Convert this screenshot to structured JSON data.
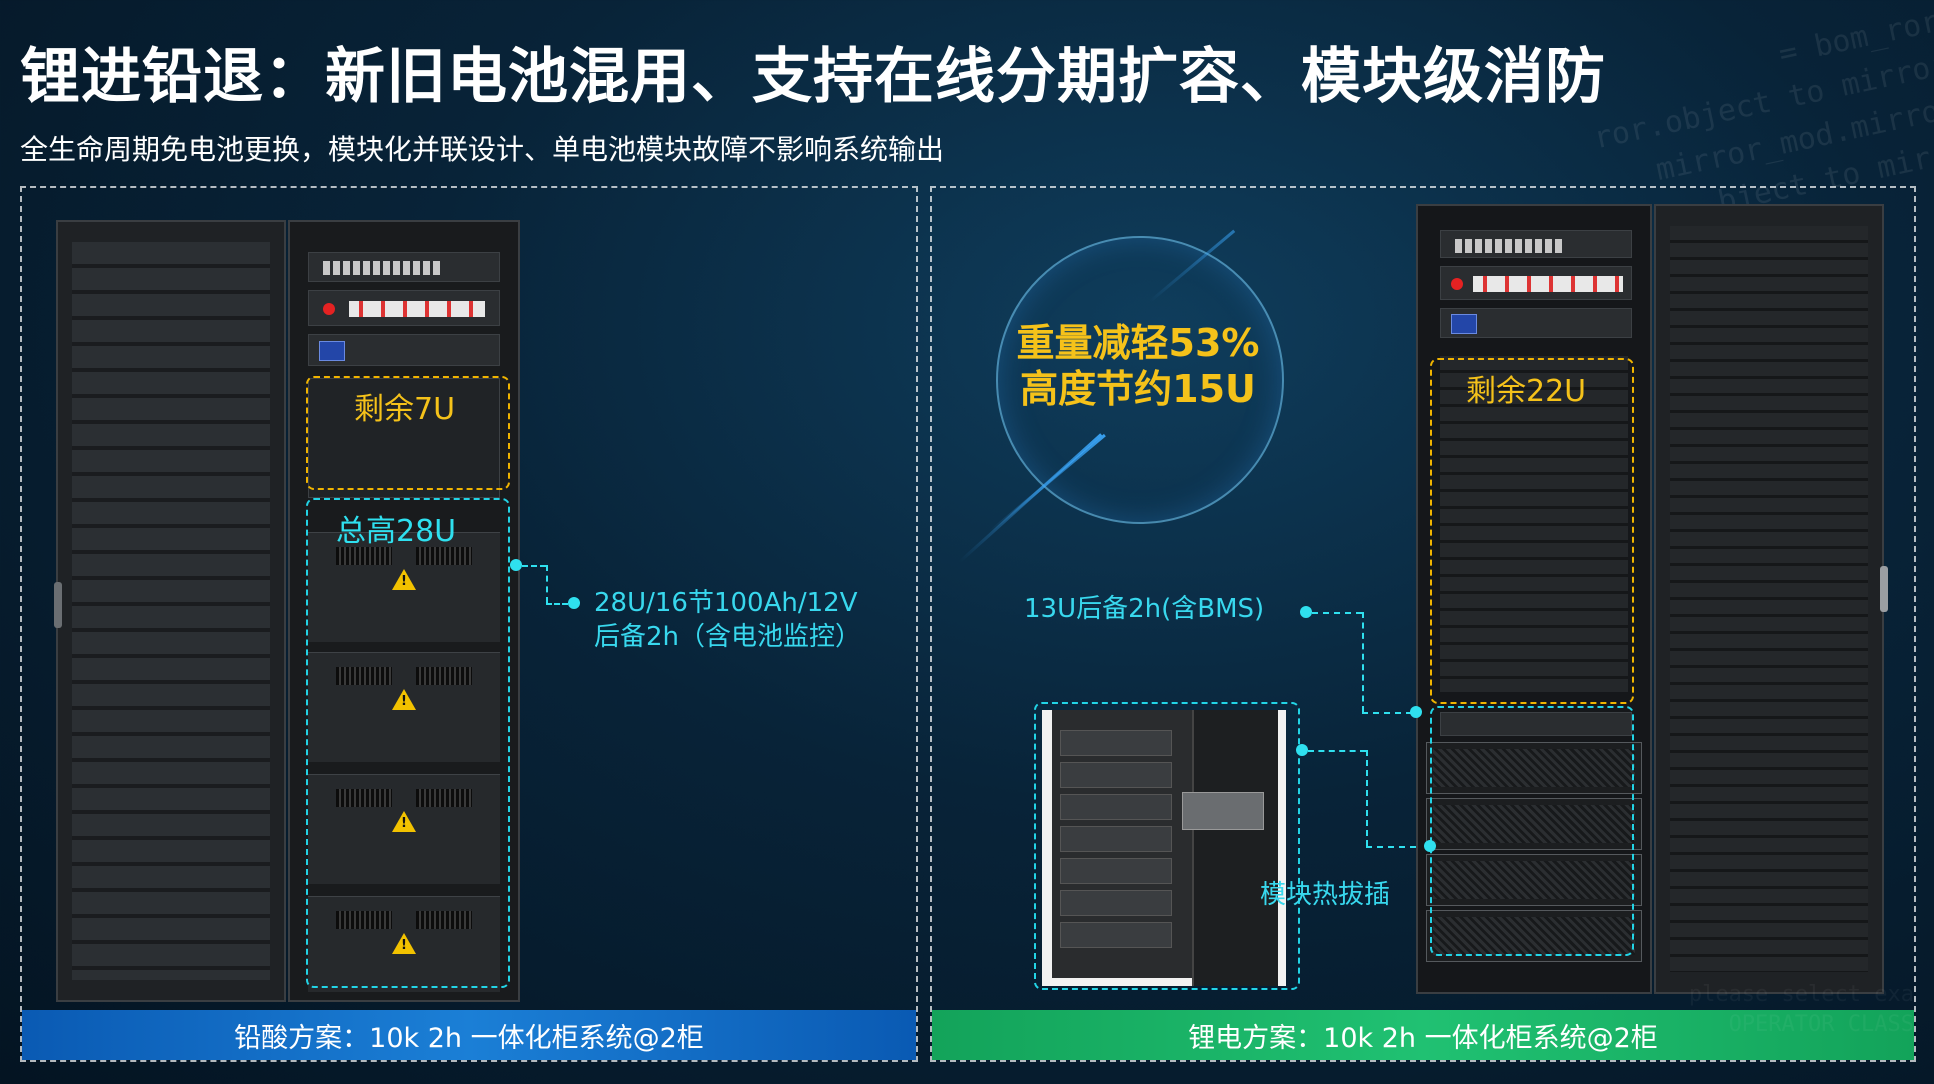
{
  "header": {
    "title": "锂进铅退：新旧电池混用、支持在线分期扩容、模块级消防",
    "subtitle": "全生命周期免电池更换，模块化并联设计、单电池模块故障不影响系统输出"
  },
  "background_code": {
    "lines": [
      "= bom_ror",
      "ror.object to mirror",
      "mirror_mod.mirror",
      "bject to mirro"
    ]
  },
  "left_panel": {
    "remaining_label": "剩余7U",
    "total_height_label": "总高28U",
    "spec_line1": "28U/16节100Ah/12V",
    "spec_line2": "后备2h（含电池监控）",
    "footer": "铅酸方案：10k 2h  一体化柜系统@2柜"
  },
  "right_panel": {
    "circle_line1": "重量减轻53%",
    "circle_line2": "高度节约15U",
    "remaining_label": "剩余22U",
    "backup_label": "13U后备2h(含BMS)",
    "hotswap_label": "模块热拔插",
    "footer": "锂电方案：10k 2h  一体化柜系统@2柜",
    "bottom_code": [
      "please select exa",
      "OPERATOR CLASS"
    ]
  },
  "colors": {
    "accent_yellow": "#f5c21a",
    "accent_cyan": "#2fe0ef",
    "footer_blue": "#1b7fd6",
    "footer_green": "#20c172"
  }
}
